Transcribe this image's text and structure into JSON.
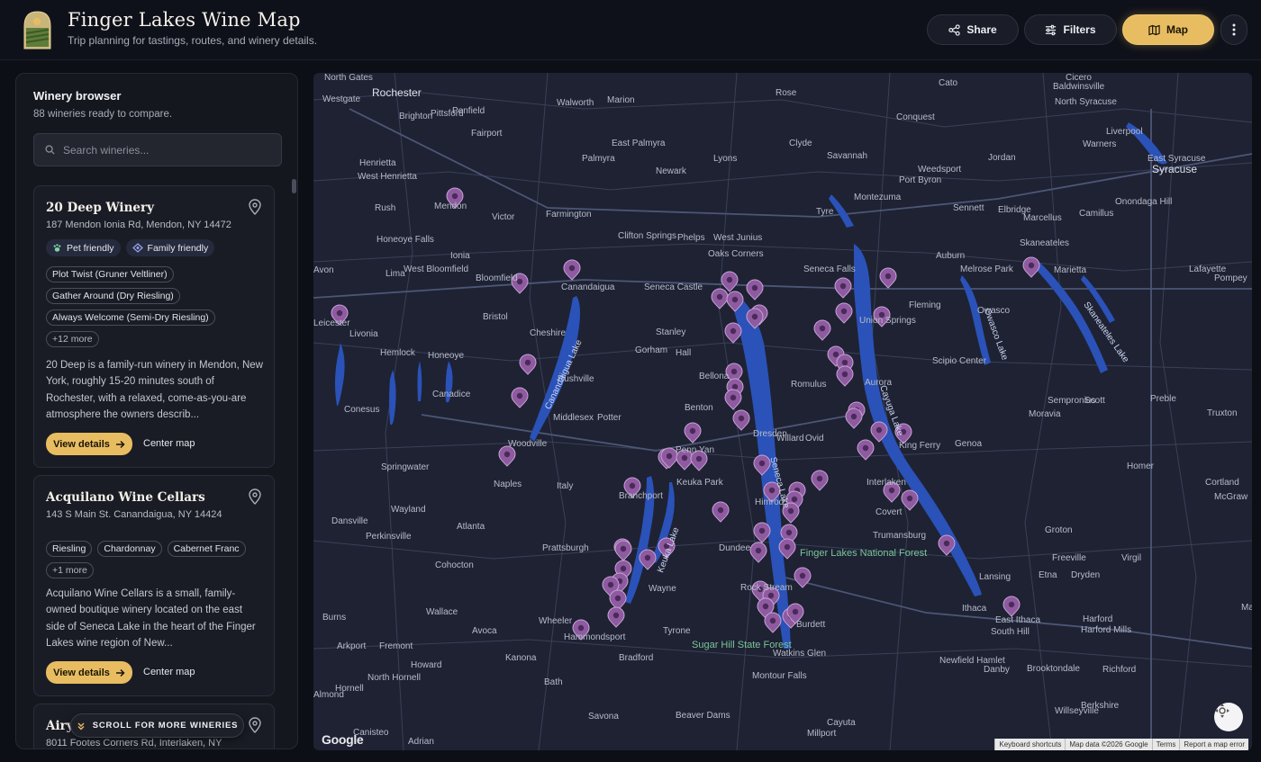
{
  "app": {
    "title": "Finger Lakes Wine Map",
    "subtitle": "Trip planning for tastings, routes, and winery details."
  },
  "header": {
    "share_label": "Share",
    "filters_label": "Filters",
    "map_label": "Map",
    "more_icon": "more-vertical-icon"
  },
  "sidebar": {
    "title": "Winery browser",
    "count_text": "88 wineries ready to compare.",
    "search_placeholder": "Search wineries...",
    "scroll_hint": "SCROLL FOR MORE WINERIES",
    "wineries": [
      {
        "name": "20 Deep Winery",
        "address": "187 Mendon Ionia Rd, Mendon, NY 14472",
        "badges": [
          "Pet friendly",
          "Family friendly"
        ],
        "wines": [
          "Plot Twist (Gruner Veltliner)",
          "Gather Around (Dry Riesling)",
          "Always Welcome (Semi-Dry Riesling)"
        ],
        "more": "+12 more",
        "description": "20 Deep is a family-run winery in Mendon, New York, roughly 15-20 minutes south of Rochester, with a relaxed, come-as-you-are atmosphere the owners describ...",
        "view_label": "View details",
        "center_label": "Center map"
      },
      {
        "name": "Acquilano Wine Cellars",
        "address": "143 S Main St. Canandaigua, NY 14424",
        "wines": [
          "Riesling",
          "Chardonnay",
          "Cabernet Franc"
        ],
        "more": "+1 more",
        "description": "Acquilano Wine Cellars is a small, family-owned boutique winery located on the east side of Seneca Lake in the heart of the Finger Lakes wine region of New...",
        "view_label": "View details",
        "center_label": "Center map"
      },
      {
        "name": "Airy",
        "address": "8011 Footes Corners Rd, Interlaken, NY"
      }
    ]
  },
  "map": {
    "places": [
      "North Gates",
      "Rochester",
      "Westgate",
      "Brighton",
      "Penfield",
      "Walworth",
      "Marion",
      "Rose",
      "Cato",
      "Baldwinsville",
      "North Syracuse",
      "Cicero",
      "Pittsford",
      "Fairport",
      "East Palmyra",
      "Clyde",
      "Conquest",
      "Liverpool",
      "Henrietta",
      "Palmyra",
      "Newark",
      "Lyons",
      "Savannah",
      "Warners",
      "Weedsport",
      "Jordan",
      "Syracuse",
      "West Henrietta",
      "Port Byron",
      "East Syracuse",
      "Mendon",
      "Rush",
      "Victor",
      "Farmington",
      "Tyre",
      "Montezuma",
      "Elbridge",
      "Camillus",
      "Sennett",
      "Marcellus",
      "Onondaga Hill",
      "Honeoye Falls",
      "Clifton Springs",
      "Phelps",
      "West Junius",
      "Ionia",
      "Oaks Corners",
      "Auburn",
      "Skaneateles",
      "Avon",
      "Lima",
      "West Bloomfield",
      "Bloomfield",
      "Canandaigua",
      "Seneca Castle",
      "Seneca Falls",
      "Melrose Park",
      "Marietta",
      "Lafayette",
      "Pompey",
      "Leicester",
      "Livonia",
      "Bristol",
      "Union Springs",
      "Fleming",
      "Owasco",
      "Cheshire",
      "Stanley",
      "Hemlock",
      "Honeoye",
      "Gorham",
      "Hall",
      "Scipio Center",
      "Romulus",
      "Aurora",
      "Rushville",
      "Bellona",
      "Canadice",
      "Sempronius",
      "Scott",
      "Preble",
      "Truxton",
      "Conesus",
      "Benton",
      "Middlesex",
      "Potter",
      "Dresden",
      "Willard",
      "Ovid",
      "Moravia",
      "Woodville",
      "Penn Yan",
      "King Ferry",
      "Genoa",
      "Springwater",
      "Naples",
      "Italy",
      "Keuka Park",
      "Branchport",
      "Interlaken",
      "Homer",
      "Cortland",
      "McGraw",
      "Dansville",
      "Wayland",
      "Himrod",
      "Covert",
      "Groton",
      "Perkinsville",
      "Atlanta",
      "Prattsburgh",
      "Dundee",
      "Trumansburg",
      "Freeville",
      "Virgil",
      "Cohocton",
      "Lansing",
      "Etna",
      "Dryden",
      "Hammondsport",
      "Wayne",
      "Rock Stream",
      "Ithaca",
      "East Ithaca",
      "Harford",
      "Harford Mills",
      "Marathon",
      "Burns",
      "Wallace",
      "Wheeler",
      "Avoca",
      "Tyrone",
      "Burdett",
      "South Hill",
      "Arkport",
      "Fremont",
      "Kanona",
      "Howard",
      "Bradford",
      "Watkins Glen",
      "Newfield Hamlet",
      "Danby",
      "Brooktondale",
      "Richford",
      "North Hornell",
      "Hornell",
      "Bath",
      "Montour Falls",
      "Almond",
      "Savona",
      "Beaver Dams",
      "Cayuta",
      "Willseyville",
      "Berkshire",
      "Canisteo",
      "Adrian",
      "Millport"
    ],
    "lakes": [
      "Canandaigua Lake",
      "Keuka Lake",
      "Seneca Lake",
      "Cayuga Lake",
      "Owasco Lake",
      "Skaneateles Lake"
    ],
    "parks": [
      "Finger Lakes National Forest",
      "Sugar Hill State Forest"
    ],
    "attribution": [
      "Keyboard shortcuts",
      "Map data ©2026 Google",
      "Terms",
      "Report a map error"
    ],
    "google_logo": "Google"
  },
  "colors": {
    "accent": "#e8bd62",
    "water": "#2a52b8",
    "pin": "#8e5aa0",
    "map_bg": "#1e2233"
  }
}
